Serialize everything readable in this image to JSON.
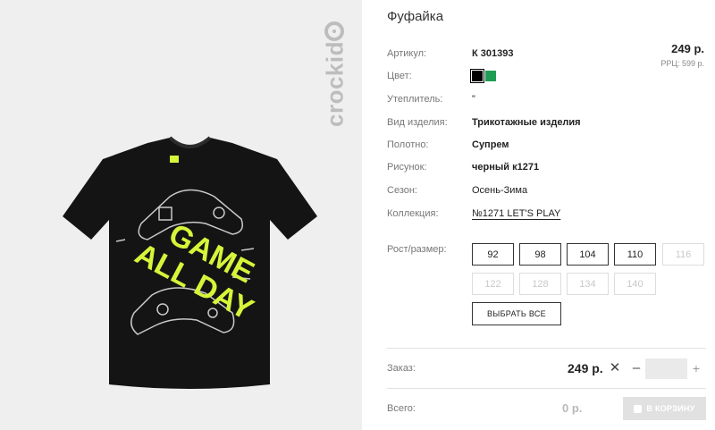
{
  "brand": {
    "name": "crockid"
  },
  "product": {
    "title": "Фуфайка",
    "price": "249 р.",
    "rrc": "РРЦ: 599 р."
  },
  "attributes": {
    "article": {
      "label": "Артикул:",
      "value": "К 301393"
    },
    "color": {
      "label": "Цвет:",
      "swatches": [
        "#000000",
        "#1f9d55"
      ]
    },
    "insulation": {
      "label": "Утеплитель:",
      "value": "\""
    },
    "type": {
      "label": "Вид изделия:",
      "value": "Трикотажные изделия"
    },
    "fabric": {
      "label": "Полотно:",
      "value": "Супрем"
    },
    "pattern": {
      "label": "Рисунок:",
      "value": "черный к1271"
    },
    "season": {
      "label": "Сезон:",
      "value": "Осень-Зима"
    },
    "collection": {
      "label": "Коллекция:",
      "value": "№1271 LET'S PLAY"
    }
  },
  "sizes": {
    "label": "Рост/размер:",
    "options": [
      {
        "value": "92",
        "available": true
      },
      {
        "value": "98",
        "available": true
      },
      {
        "value": "104",
        "available": true
      },
      {
        "value": "110",
        "available": true
      },
      {
        "value": "116",
        "available": false
      },
      {
        "value": "122",
        "available": false
      },
      {
        "value": "128",
        "available": false
      },
      {
        "value": "134",
        "available": false
      },
      {
        "value": "140",
        "available": false
      }
    ],
    "select_all": "ВЫБРАТЬ ВСЕ"
  },
  "order": {
    "label": "Заказ:",
    "price": "249 р.",
    "quantity": ""
  },
  "total": {
    "label": "Всего:",
    "value": "0 р.",
    "cart_button": "В КОРЗИНУ"
  },
  "print_text": {
    "line1": "GAME",
    "line2": "ALL DAY"
  }
}
